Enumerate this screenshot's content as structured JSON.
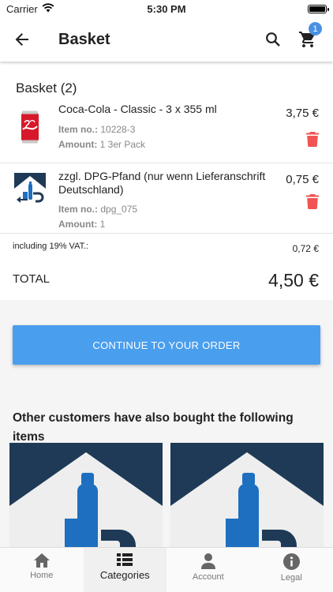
{
  "status_bar": {
    "carrier": "Carrier",
    "time": "5:30 PM"
  },
  "header": {
    "title": "Basket",
    "cart_count": "1"
  },
  "basket": {
    "heading": "Basket (2)",
    "items": [
      {
        "name": "Coca-Cola - Classic - 3 x 355 ml",
        "item_no_label": "Item no.:",
        "item_no": "10228-3",
        "amount_label": "Amount:",
        "amount": "1 3er Pack",
        "price": "3,75 €",
        "image_icon": "coca-cola-can-icon"
      },
      {
        "name": "zzgl. DPG-Pfand (nur wenn Lieferanschrift Deutschland)",
        "item_no_label": "Item no.:",
        "item_no": "dpg_075",
        "amount_label": "Amount:",
        "amount": "1",
        "price": "0,75 €",
        "image_icon": "dpg-deposit-logo-icon"
      }
    ],
    "vat_label": "including 19% VAT.:",
    "vat_value": "0,72 €",
    "total_label": "TOTAL",
    "total_value": "4,50 €"
  },
  "actions": {
    "continue_label": "CONTINUE TO YOUR ORDER"
  },
  "recommendations": {
    "title": "Other customers have also bought the following items"
  },
  "bottom_nav": [
    {
      "label": "Home",
      "icon": "home-icon"
    },
    {
      "label": "Categories",
      "icon": "categories-icon"
    },
    {
      "label": "Account",
      "icon": "account-icon"
    },
    {
      "label": "Legal",
      "icon": "info-icon"
    }
  ],
  "colors": {
    "accent": "#4a9eee",
    "badge": "#4a90e2",
    "delete": "#f05454",
    "dpg_navy": "#1e3a57",
    "dpg_blue": "#1e6fbf"
  }
}
